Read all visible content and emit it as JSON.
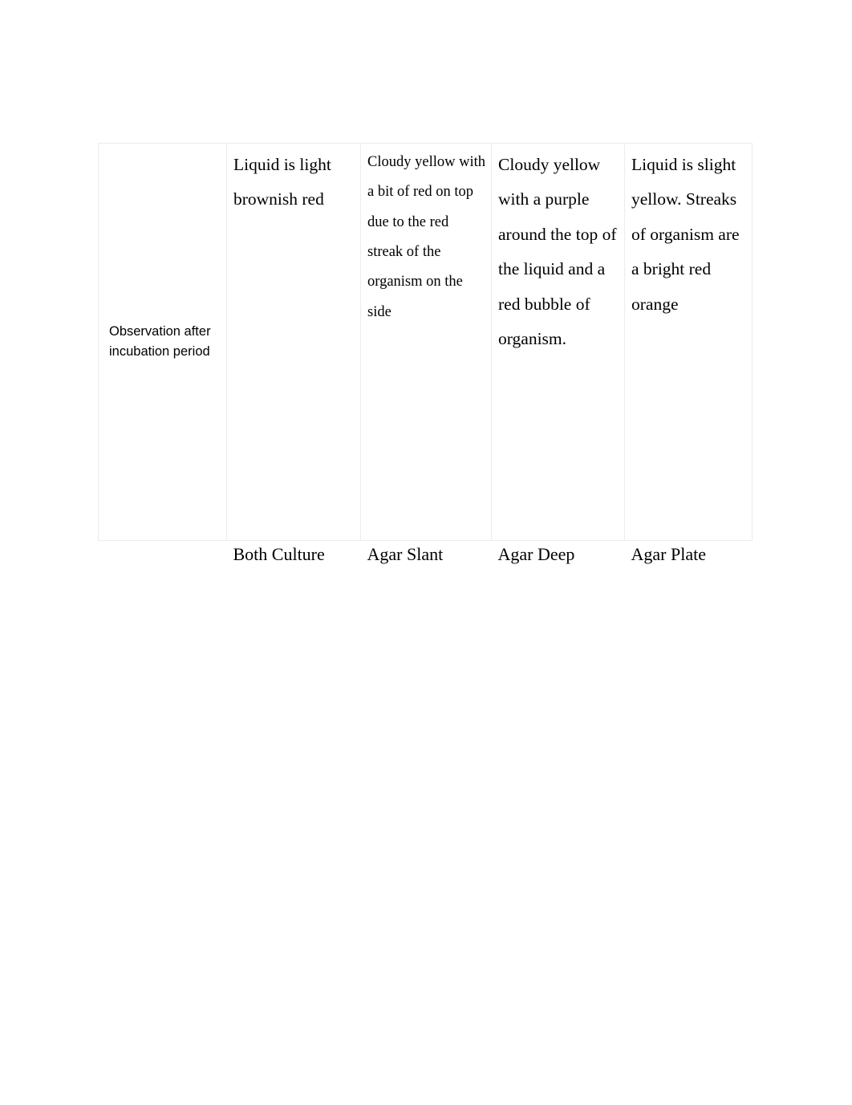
{
  "document": {
    "type": "lab-observation-table",
    "background_color": "#ffffff",
    "text_color": "#000000",
    "border_color": "#ececec"
  },
  "table": {
    "row_label": "Observation after incubation period",
    "cells": {
      "broth_culture": "Liquid is light brownish red",
      "agar_slant": "Cloudy yellow with a bit of red on top due to the red streak of the organism on the side",
      "agar_deep": "Cloudy yellow with a purple around the top of the liquid and a red bubble of organism.",
      "agar_plate": "Liquid is slight yellow. Streaks of organism are a bright red orange"
    },
    "footer": {
      "blank": "",
      "broth_culture": "Both Culture",
      "agar_slant": "Agar Slant",
      "agar_deep": "Agar Deep",
      "agar_plate": "Agar Plate"
    }
  }
}
